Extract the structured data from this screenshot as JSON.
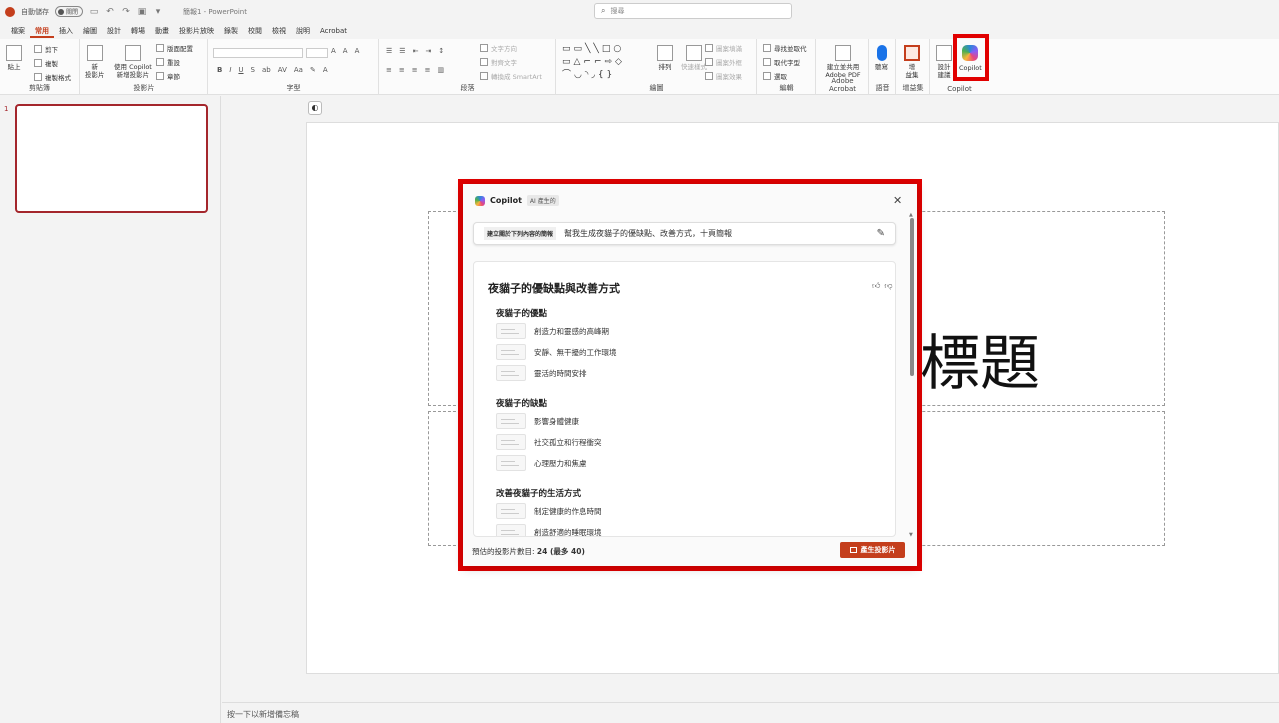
{
  "titlebar": {
    "autosave_label": "自動儲存",
    "autosave_state": "關閉",
    "doc_title": "簡報1 - PowerPoint",
    "search_placeholder": "搜尋"
  },
  "tabs": [
    "檔案",
    "常用",
    "插入",
    "繪圖",
    "設計",
    "轉場",
    "動畫",
    "投影片放映",
    "錄製",
    "校閱",
    "檢視",
    "說明",
    "Acrobat"
  ],
  "ribbon": {
    "clipboard": {
      "paste": "貼上",
      "cut": "剪下",
      "copy": "複製",
      "format_painter": "複製格式",
      "label": "剪貼簿"
    },
    "slides": {
      "new_slide": "新\n投影片",
      "copilot_new": "使用 Copilot\n新增投影片",
      "layout": "版面配置",
      "reset": "重設",
      "section": "章節",
      "label": "投影片"
    },
    "font": {
      "label": "字型"
    },
    "paragraph": {
      "text_direction": "文字方向",
      "align_text": "對齊文字",
      "smartart": "轉換成 SmartArt",
      "label": "段落"
    },
    "drawing": {
      "arrange": "排列",
      "quick_styles": "快速樣式",
      "shape_fill": "圖案填滿",
      "shape_outline": "圖案外框",
      "shape_effects": "圖案效果",
      "label": "繪圖"
    },
    "editing": {
      "find": "尋找並取代",
      "replace": "取代字型",
      "select": "選取",
      "label": "編輯"
    },
    "acrobat": {
      "create_pdf": "建立並共用\nAdobe PDF",
      "label": "Adobe Acrobat"
    },
    "voice": {
      "dictate": "聽寫",
      "label": "語音"
    },
    "addins": {
      "addins": "增\n益集",
      "label": "增益集"
    },
    "copilot": {
      "designer": "設計\n建議",
      "copilot": "Copilot",
      "label": "Copilot"
    }
  },
  "slide_panel": {
    "slide_number": "1"
  },
  "slide": {
    "title": "標題"
  },
  "notes": {
    "placeholder": "按一下以新增備忘稿"
  },
  "dialog": {
    "title": "Copilot",
    "badge": "AI 產生的",
    "prompt_label": "建立關於下列內容的簡報",
    "prompt_text": "幫我生成夜貓子的優缺點、改善方式，十頁簡報",
    "outline_title": "夜貓子的優缺點與改善方式",
    "sections": [
      {
        "heading": "夜貓子的優點",
        "items": [
          "創造力和靈感的高峰期",
          "安靜、無干擾的工作環境",
          "靈活的時間安排"
        ]
      },
      {
        "heading": "夜貓子的缺點",
        "items": [
          "影響身體健康",
          "社交孤立和行程衝突",
          "心理壓力和焦慮"
        ]
      },
      {
        "heading": "改善夜貓子的生活方式",
        "items": [
          "制定健康的作息時間",
          "創造舒適的睡眠環境"
        ]
      }
    ],
    "footer_prefix": "預估的投影片數目: ",
    "footer_count": "24 (最多 40)",
    "create_button": "產生投影片"
  }
}
